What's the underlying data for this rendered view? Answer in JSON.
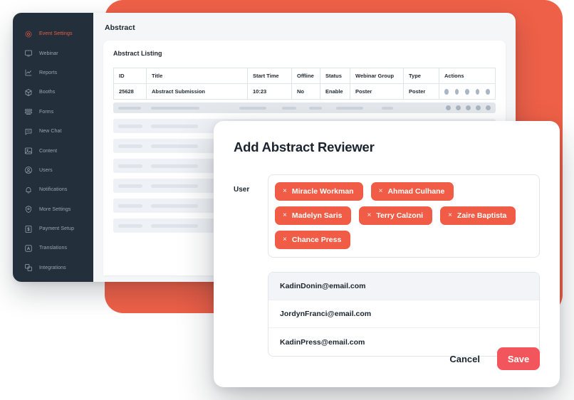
{
  "theme": {
    "orange_panel": "#ee6048",
    "sidebar_bg": "#232f3a",
    "accent_chip": "#f05c45",
    "save_button": "#f2555b",
    "active_nav": "#f05c45"
  },
  "sidebar": {
    "items": [
      {
        "label": "Event Settings",
        "icon": "gear-icon",
        "active": true
      },
      {
        "label": "Webinar",
        "icon": "monitor-icon",
        "active": false
      },
      {
        "label": "Reports",
        "icon": "chart-line-icon",
        "active": false
      },
      {
        "label": "Booths",
        "icon": "cube-icon",
        "active": false
      },
      {
        "label": "Forms",
        "icon": "forms-icon",
        "active": false
      },
      {
        "label": "New Chat",
        "icon": "chat-icon",
        "active": false
      },
      {
        "label": "Content",
        "icon": "image-icon",
        "active": false
      },
      {
        "label": "Users",
        "icon": "user-circle-icon",
        "active": false
      },
      {
        "label": "Notifications",
        "icon": "bell-icon",
        "active": false
      },
      {
        "label": "More Settings",
        "icon": "settings-badge-icon",
        "active": false
      },
      {
        "label": "Payment Setup",
        "icon": "dollar-card-icon",
        "active": false
      },
      {
        "label": "Translations",
        "icon": "translate-icon",
        "active": false
      },
      {
        "label": "Integrations",
        "icon": "layers-icon",
        "active": false
      }
    ]
  },
  "main": {
    "page_title": "Abstract",
    "card_title": "Abstract Listing",
    "table": {
      "columns": [
        "ID",
        "Title",
        "Start Time",
        "Offline",
        "Status",
        "Webinar Group",
        "Type",
        "Actions"
      ],
      "rows": [
        {
          "id": "25628",
          "title": "Abstract Submission",
          "start_time": "10:23",
          "offline": "No",
          "status": "Enable",
          "webinar_group": "Poster",
          "type": "Poster",
          "action_dot_count": 5
        }
      ],
      "skeleton_row_count": 6
    }
  },
  "modal": {
    "title": "Add Abstract Reviewer",
    "user_field_label": "User",
    "chips": [
      {
        "name": "Miracle Workman",
        "remove": "×"
      },
      {
        "name": "Ahmad Culhane",
        "remove": "×"
      },
      {
        "name": "Madelyn Saris",
        "remove": "×"
      },
      {
        "name": "Terry Calzoni",
        "remove": "×"
      },
      {
        "name": "Zaire Baptista",
        "remove": "×"
      },
      {
        "name": "Chance Press",
        "remove": "×"
      }
    ],
    "suggestions": [
      {
        "email": "KadinDonin@email.com",
        "highlighted": true
      },
      {
        "email": "JordynFranci@email.com",
        "highlighted": false
      },
      {
        "email": "KadinPress@email.com",
        "highlighted": false
      }
    ],
    "cancel_label": "Cancel",
    "save_label": "Save"
  }
}
